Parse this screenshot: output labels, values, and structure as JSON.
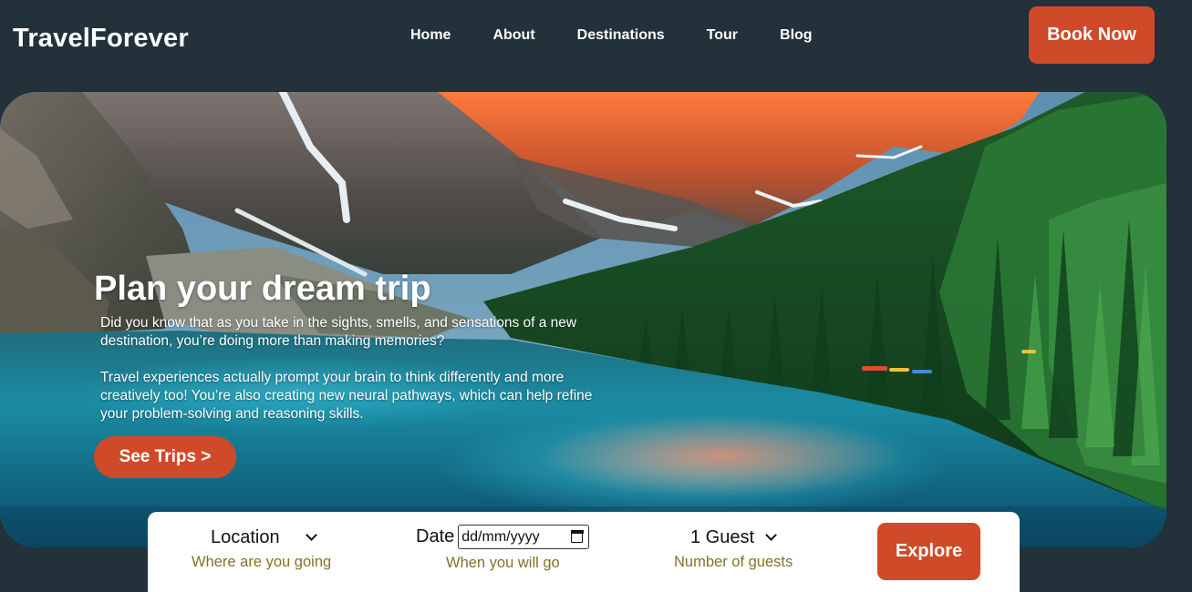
{
  "brand": {
    "name": "TravelForever"
  },
  "nav": {
    "items": [
      {
        "label": "Home"
      },
      {
        "label": "About"
      },
      {
        "label": "Destinations"
      },
      {
        "label": "Tour"
      },
      {
        "label": "Blog"
      }
    ],
    "cta_label": "Book Now"
  },
  "hero": {
    "title": "Plan your dream trip",
    "paragraph_1": "Did you know that as you take in the sights, smells, and sensations of a new destination, you’re doing more than making memories?",
    "paragraph_2": "Travel experiences actually prompt your brain to think differently and more creatively too! You’re also creating new neural pathways, which can help refine your problem-solving and reasoning skills.",
    "cta_label": "See Trips >",
    "image_icon": "mountain-lake-photo"
  },
  "search": {
    "location": {
      "value": "Location",
      "hint": "Where are you going"
    },
    "date": {
      "label": "Date",
      "value": "dd/mm/yyyy",
      "hint": "When you will go"
    },
    "guests": {
      "value": "1 Guest",
      "hint": "Number of guests"
    },
    "explore_label": "Explore"
  },
  "colors": {
    "background": "#22313a",
    "accent": "#cf4a28",
    "hint": "#7f7425"
  }
}
